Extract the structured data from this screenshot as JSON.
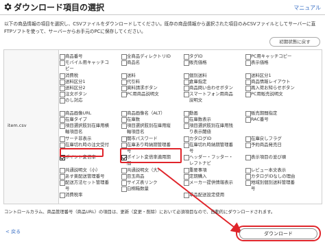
{
  "header": {
    "title": "ダウンロード項目の選択",
    "manual": "マニュアル"
  },
  "description": [
    "以下の商品情報の項目を選択し、CSVファイルをダウンロードしてください。既存の商品情報から選択された項目のみCSVファイルとしてサーバーに直",
    "FTPソフトを使って、サーバーからお手元のPCに保存してください。"
  ],
  "reset_button": "初期状態に戻す",
  "file_label": "item.csv",
  "columns": [
    [
      {
        "label": "商品番号",
        "checked": false
      },
      {
        "label": "モバイル用キャッチコ",
        "checked": false
      },
      {
        "label": "ピー",
        "checked": false,
        "cont": true
      },
      {
        "label": "消費税",
        "checked": false
      },
      {
        "label": "送料区分1",
        "checked": false
      },
      {
        "label": "送料区分2",
        "checked": false
      },
      {
        "label": "注文ボタン",
        "checked": false
      },
      {
        "label": "のし対応",
        "checked": false
      },
      {
        "label": "",
        "checked": false,
        "blank": true
      },
      {
        "label": "商品画像URL",
        "checked": false
      },
      {
        "label": "在庫タイプ",
        "checked": false
      },
      {
        "label": "項目選択肢別在庫用横",
        "checked": false
      },
      {
        "label": "軸項目名",
        "checked": false,
        "cont": true
      },
      {
        "label": "サーチ非表示",
        "checked": false
      },
      {
        "label": "在庫切れ時の注文受付",
        "checked": false
      },
      {
        "label": "",
        "checked": false,
        "blank": true
      },
      {
        "label": "ポイント変倍率",
        "checked": true
      },
      {
        "label": "",
        "checked": false,
        "blank": true
      },
      {
        "label": "共通説明文（小）",
        "checked": false
      },
      {
        "label": "あす楽配送管理番号",
        "checked": false
      },
      {
        "label": "配送方法セット管理番",
        "checked": false
      },
      {
        "label": "号",
        "checked": false,
        "cont": true
      },
      {
        "label": "消費税率",
        "checked": false
      }
    ],
    [
      {
        "label": "全商品ディレクトリID",
        "checked": false
      },
      {
        "label": "商品名",
        "checked": false
      },
      {
        "label": "",
        "checked": false,
        "blank": true
      },
      {
        "label": "送料",
        "checked": false
      },
      {
        "label": "代引料",
        "checked": false
      },
      {
        "label": "資料請求ボタン",
        "checked": false
      },
      {
        "label": "PC用商品説明文",
        "checked": false
      },
      {
        "label": "",
        "checked": false,
        "blank": true
      },
      {
        "label": "",
        "checked": false,
        "blank": true
      },
      {
        "label": "商品画像名（ALT）",
        "checked": false
      },
      {
        "label": "在庫数",
        "checked": false
      },
      {
        "label": "項目選択肢別在庫用縦",
        "checked": false
      },
      {
        "label": "軸項目名",
        "checked": false,
        "cont": true
      },
      {
        "label": "闇市パスワード",
        "checked": false
      },
      {
        "label": "在庫あり時納期管理番",
        "checked": false
      },
      {
        "label": "号",
        "checked": false,
        "cont": true
      },
      {
        "label": "ポイント変倍率適用期",
        "checked": true
      },
      {
        "label": "間",
        "checked": false,
        "cont": true
      },
      {
        "label": "共通説明文（大）",
        "checked": false
      },
      {
        "label": "目玉商品",
        "checked": false
      },
      {
        "label": "サイズ表リンク",
        "checked": false
      },
      {
        "label": "白桐箱数量",
        "checked": false
      },
      {
        "label": "",
        "checked": false,
        "blank": true
      }
    ],
    [
      {
        "label": "タグID",
        "checked": false
      },
      {
        "label": "販売価格",
        "checked": false
      },
      {
        "label": "",
        "checked": false,
        "blank": true
      },
      {
        "label": "個別送料",
        "checked": false
      },
      {
        "label": "倉庫指定",
        "checked": false
      },
      {
        "label": "商品問い合わせボタン",
        "checked": false
      },
      {
        "label": "スマートフォン用商品",
        "checked": false
      },
      {
        "label": "説明文",
        "checked": false,
        "cont": true
      },
      {
        "label": "",
        "checked": false,
        "blank": true
      },
      {
        "label": "動画",
        "checked": false
      },
      {
        "label": "在庫数表示",
        "checked": false
      },
      {
        "label": "項目選択肢別在庫用残",
        "checked": false
      },
      {
        "label": "り表示閾値",
        "checked": false,
        "cont": true
      },
      {
        "label": "カタログID",
        "checked": false
      },
      {
        "label": "在庫切れ時納期管理番",
        "checked": false
      },
      {
        "label": "号",
        "checked": false,
        "cont": true
      },
      {
        "label": "ヘッダー・フッター・",
        "checked": false
      },
      {
        "label": "レフトナビ",
        "checked": false,
        "cont": true
      },
      {
        "label": "重要事項",
        "checked": false
      },
      {
        "label": "定期購入",
        "checked": false
      },
      {
        "label": "メーカー提供情報表示",
        "checked": false
      },
      {
        "label": "",
        "checked": false,
        "blank": true
      },
      {
        "label": "単品配送設定使用",
        "checked": false
      }
    ],
    [
      {
        "label": "PC用キャッチコピー",
        "checked": false
      },
      {
        "label": "表示価格",
        "checked": false
      },
      {
        "label": "",
        "checked": false,
        "blank": true
      },
      {
        "label": "送料区分1",
        "checked": false
      },
      {
        "label": "商品情報レイアウト",
        "checked": false
      },
      {
        "label": "再入荷お知らせボタン",
        "checked": false
      },
      {
        "label": "PC用販売説明文",
        "checked": false
      },
      {
        "label": "",
        "checked": false,
        "blank": true
      },
      {
        "label": "",
        "checked": false,
        "blank": true
      },
      {
        "label": "販売期間指定",
        "checked": false
      },
      {
        "label": "RAC番号",
        "checked": false
      },
      {
        "label": "",
        "checked": false,
        "blank": true
      },
      {
        "label": "",
        "checked": false,
        "blank": true
      },
      {
        "label": "在庫戻しフラグ",
        "checked": false
      },
      {
        "label": "予約商品発売日",
        "checked": false
      },
      {
        "label": "",
        "checked": false,
        "blank": true
      },
      {
        "label": "表示項目の並び順",
        "checked": false
      },
      {
        "label": "",
        "checked": false,
        "blank": true
      },
      {
        "label": "レビュー本文表示",
        "checked": false
      },
      {
        "label": "カタログIDなしの理由",
        "checked": false
      },
      {
        "label": "地域別個別送料管理番",
        "checked": false
      },
      {
        "label": "号",
        "checked": false,
        "cont": true
      },
      {
        "label": "",
        "checked": false,
        "blank": true
      }
    ]
  ],
  "footer_note": "コントロールカラム、商品管理番号（商品URL）の項目は、更新（変更・削除）において必須項目なので、自動的にダウンロードされます。",
  "back_link": "< 戻る",
  "download_button": "ダウンロード",
  "colors": {
    "highlight": "#e0242a",
    "link": "#3a6fc4"
  }
}
